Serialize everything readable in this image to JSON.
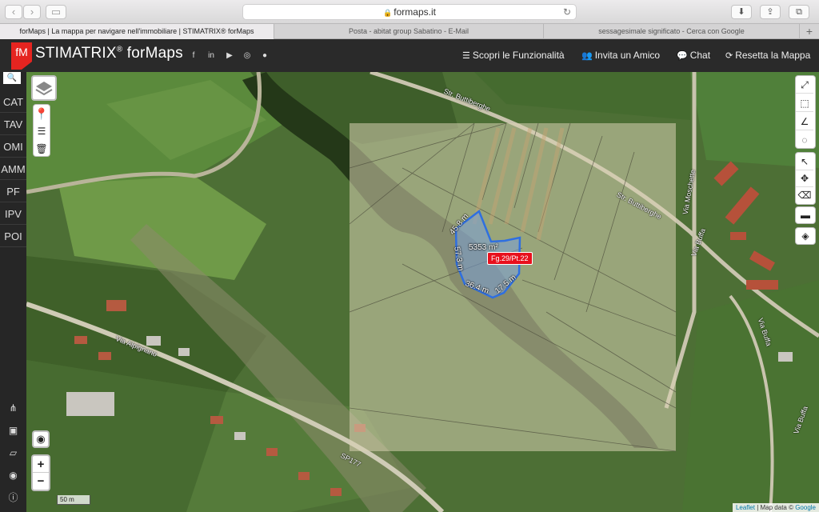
{
  "browser": {
    "url": "formaps.it",
    "tabs": [
      {
        "title": "forMaps | La mappa per navigare nell'immobiliare | STIMATRIX® forMaps",
        "active": true
      },
      {
        "title": "Posta - abitat group Sabatino - E-Mail",
        "active": false
      },
      {
        "title": "sessagesimale significato - Cerca con Google",
        "active": false
      }
    ],
    "new_tab": "+"
  },
  "header": {
    "logo": "fM",
    "brand": "STIMATRIX",
    "brand_mark": "®",
    "brand_suffix": " forMaps",
    "links": [
      {
        "icon": "list-icon",
        "label": "Scopri le Funzionalità"
      },
      {
        "icon": "users-icon",
        "label": "Invita un Amico"
      },
      {
        "icon": "chat-icon",
        "label": "Chat"
      },
      {
        "icon": "refresh-icon",
        "label": "Resetta la Mappa"
      }
    ]
  },
  "side_tabs": [
    "CAT",
    "TAV",
    "OMI",
    "AMM",
    "PF",
    "IPV",
    "POI"
  ],
  "map": {
    "parcel_label": "Fg.29/Pt.22",
    "area": "5353 m²",
    "measurements": [
      "45.8 m",
      "57.3 m",
      "36.4 m",
      "17.5 m"
    ],
    "roads": [
      "Str. Buttiberghe",
      "Str. Buttiberghe",
      "Via Moschette",
      "Via Buffa",
      "Via Buffa",
      "Via Buffa",
      "Via Alpignano",
      "SP177"
    ],
    "scale": "50 m",
    "zoom_in": "+",
    "zoom_out": "−",
    "attribution_leaflet": "Leaflet",
    "attribution_text": " | Map data © ",
    "attribution_google": "Google"
  },
  "colors": {
    "brand_red": "#e52420",
    "parcel_label_bg": "#e8101d",
    "parcel_outline": "#2f6fe0",
    "overlay": "#d9d2b3"
  }
}
